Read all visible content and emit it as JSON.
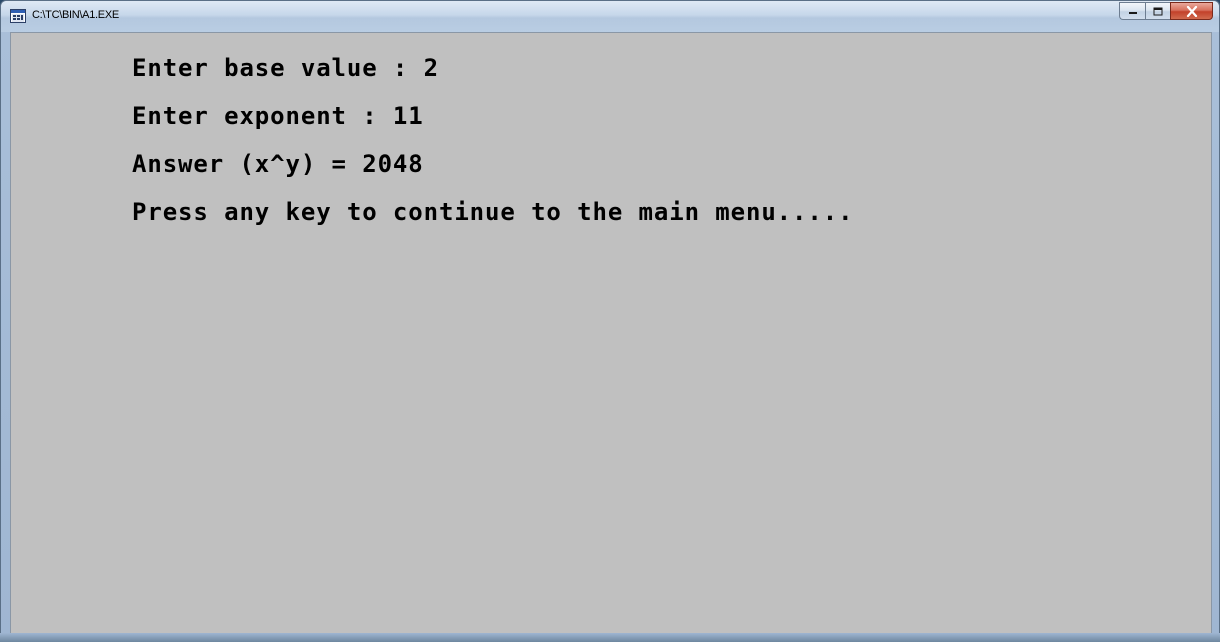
{
  "window": {
    "title": "C:\\TC\\BIN\\A1.EXE",
    "icon": "console-app-icon"
  },
  "caption_buttons": {
    "minimize_icon": "minimize-icon",
    "maximize_icon": "maximize-icon",
    "close_icon": "close-icon"
  },
  "console": {
    "background": "#c0c0c0",
    "text_color": "#000000",
    "lines": [
      "Enter base value : 2",
      "Enter exponent : 11",
      "Answer (x^y) = 2048",
      "Press any key to continue to the main menu....."
    ]
  }
}
